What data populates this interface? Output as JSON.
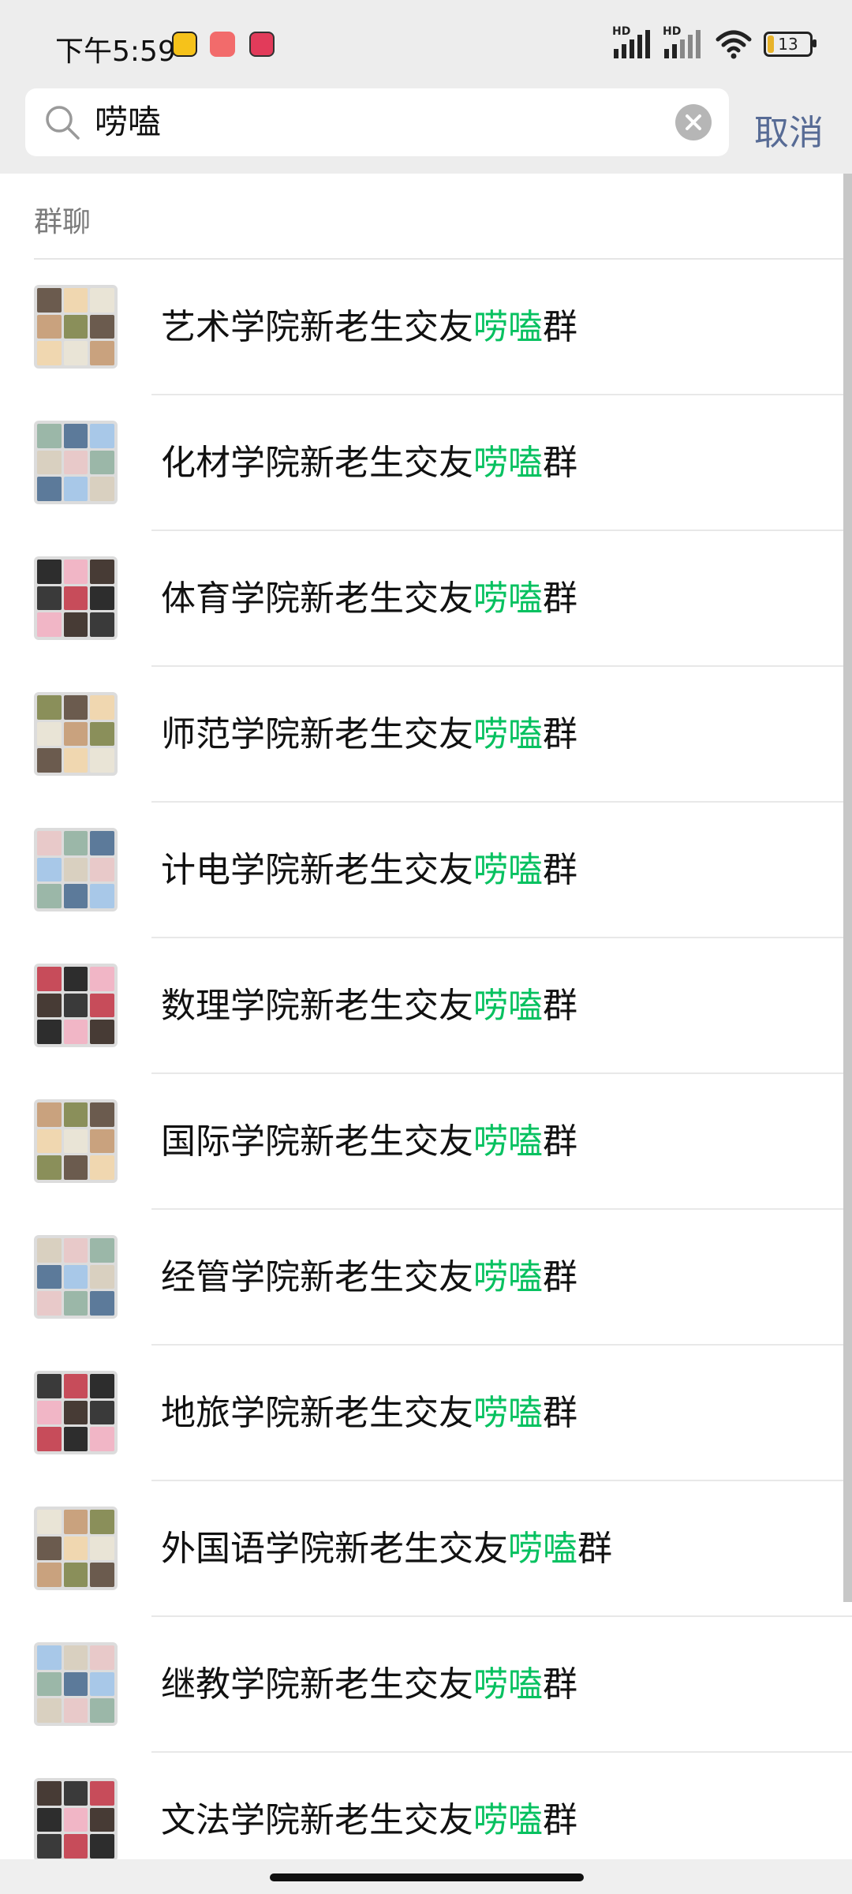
{
  "status_bar": {
    "time": "下午5:59",
    "signal_label_1": "HD",
    "signal_label_2": "HD",
    "battery": "13",
    "app_icons": [
      "notification-app-icon",
      "video-app-icon",
      "media-app-icon"
    ]
  },
  "search": {
    "query": "唠嗑",
    "cancel_label": "取消"
  },
  "section": {
    "title": "群聊"
  },
  "highlight_color": "#07c160",
  "groups": [
    {
      "prefix": "艺术学院新老生交友",
      "match": "唠嗑",
      "suffix": "群"
    },
    {
      "prefix": "化材学院新老生交友",
      "match": "唠嗑",
      "suffix": "群"
    },
    {
      "prefix": "体育学院新老生交友",
      "match": "唠嗑",
      "suffix": "群"
    },
    {
      "prefix": "师范学院新老生交友",
      "match": "唠嗑",
      "suffix": "群"
    },
    {
      "prefix": "计电学院新老生交友",
      "match": "唠嗑",
      "suffix": "群"
    },
    {
      "prefix": "数理学院新老生交友",
      "match": "唠嗑",
      "suffix": "群"
    },
    {
      "prefix": "国际学院新老生交友",
      "match": "唠嗑",
      "suffix": "群"
    },
    {
      "prefix": "经管学院新老生交友",
      "match": "唠嗑",
      "suffix": "群"
    },
    {
      "prefix": "地旅学院新老生交友",
      "match": "唠嗑",
      "suffix": "群"
    },
    {
      "prefix": "外国语学院新老生交友",
      "match": "唠嗑",
      "suffix": "群"
    },
    {
      "prefix": "继教学院新老生交友",
      "match": "唠嗑",
      "suffix": "群"
    },
    {
      "prefix": "文法学院新老生交友",
      "match": "唠嗑",
      "suffix": "群"
    }
  ]
}
